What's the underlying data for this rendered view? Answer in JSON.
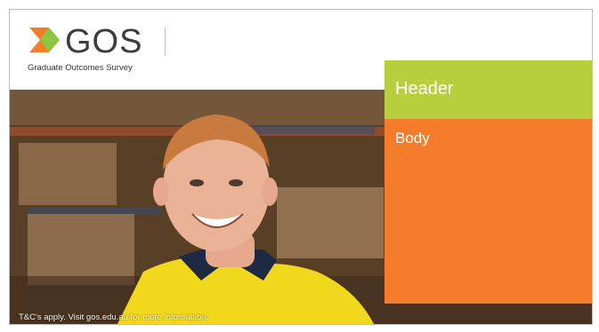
{
  "logo": {
    "name": "GOS",
    "subtitle": "Graduate Outcomes Survey",
    "mark_color": "#f47c2b",
    "mark_color_secondary": "#8cc63e"
  },
  "panel": {
    "header": "Header",
    "body": "Body",
    "header_color": "#b8cf3d",
    "body_color": "#f47c2b"
  },
  "caption": "T&C's apply. Visit gos.edu.au for more information."
}
